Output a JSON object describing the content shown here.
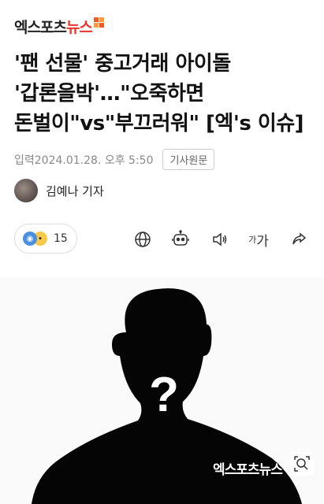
{
  "header": {
    "logo_part1": "엑스포츠",
    "logo_part2": "뉴스"
  },
  "article": {
    "title": "'팬 선물' 중고거래 아이돌 '갑론을박'…\"오죽하면 돈벌이\"vs\"부끄러워\" [엑's 이슈]",
    "published_label": "입력",
    "published": "2024.01.28. 오후 5:50",
    "original_button": "기사원문",
    "reporter": "김예나 기자"
  },
  "toolbar": {
    "reaction_count": "15",
    "font_size_small": "가",
    "font_size_large": "가",
    "icons": [
      "globe-icon",
      "robot-icon",
      "speaker-icon",
      "font-size-icon",
      "share-icon"
    ]
  },
  "image": {
    "watermark": "엑스포츠뉴스",
    "question_mark": "?"
  }
}
